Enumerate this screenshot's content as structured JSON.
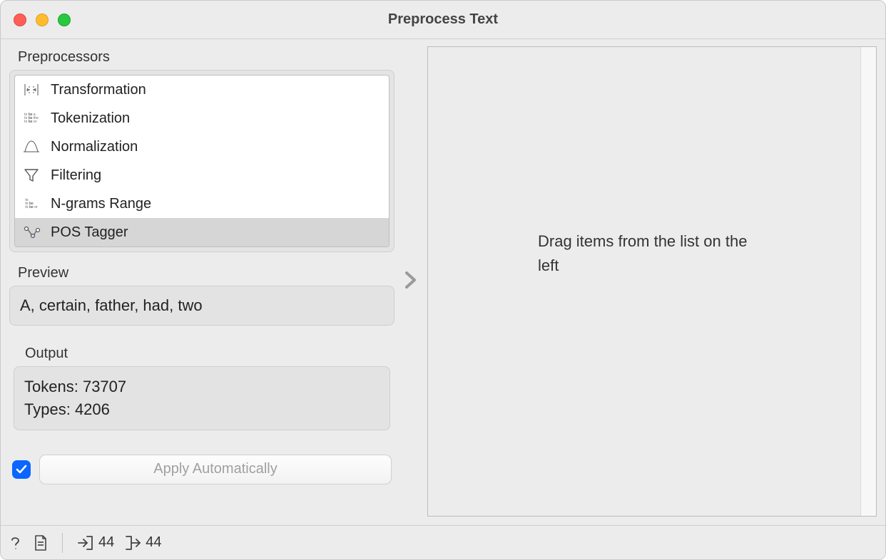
{
  "window": {
    "title": "Preprocess Text"
  },
  "preprocessors": {
    "section_label": "Preprocessors",
    "items": [
      {
        "label": "Transformation",
        "icon": "transformation-icon",
        "selected": false
      },
      {
        "label": "Tokenization",
        "icon": "tokenization-icon",
        "selected": false
      },
      {
        "label": "Normalization",
        "icon": "normalization-icon",
        "selected": false
      },
      {
        "label": "Filtering",
        "icon": "filter-icon",
        "selected": false
      },
      {
        "label": "N-grams Range",
        "icon": "ngrams-icon",
        "selected": false
      },
      {
        "label": "POS Tagger",
        "icon": "pos-tagger-icon",
        "selected": true
      }
    ]
  },
  "preview": {
    "section_label": "Preview",
    "text": "A, certain, father, had, two"
  },
  "output": {
    "section_label": "Output",
    "tokens_label": "Tokens:",
    "tokens_value": "73707",
    "types_label": "Types:",
    "types_value": "4206"
  },
  "apply": {
    "checked": true,
    "button_label": "Apply Automatically"
  },
  "drop_area": {
    "hint": "Drag items from the list on the left"
  },
  "statusbar": {
    "input_count": "44",
    "output_count": "44"
  }
}
